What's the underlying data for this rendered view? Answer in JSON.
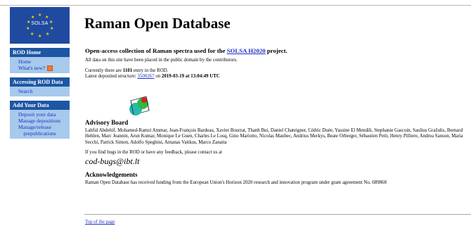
{
  "logo": {
    "text": "SOLSA"
  },
  "header": {
    "title": "Raman Open Database"
  },
  "sidebar": [
    {
      "heading": "ROD Home",
      "items": [
        {
          "label": "Home"
        },
        {
          "label": "What's new?"
        }
      ]
    },
    {
      "heading": "Accessing ROD Data",
      "items": [
        {
          "label": "Search"
        }
      ]
    },
    {
      "heading": "Add Your Data",
      "items": [
        {
          "label": "Deposit your data"
        },
        {
          "label": "Manage depositions"
        },
        {
          "label": "Manage/release"
        },
        {
          "label": "prepublications"
        }
      ]
    }
  ],
  "main": {
    "subtitle_pre": "Open-access collection of Raman spectra used for the ",
    "subtitle_link": "SOLSA H2020",
    "subtitle_post": " project.",
    "public_domain": "All data on this site have been placed in the public domain by the contributors.",
    "count_pre": "Currently there are ",
    "count": "1101",
    "count_post": " entry in the ROD.",
    "latest_pre": "Latest deposited structure: ",
    "latest_id": "3500267",
    "latest_on": " on ",
    "latest_date": "2019-03-19 at 13:04:49 UTC",
    "advisory_heading": "Advisory Board",
    "advisory_text": "Lahfid Abdeltif, Mohamed-Ramzi Ammar, Jean-François Bardeau, Xavier Bourrat, Thanh Bui, Daniel Chateigner, Cédric Duée, Yassine El Mendili, Stephanie Gascoin, Saulius Gražulis, Bernard Hehlen, Marc Jeannin, Arun Kumar, Monique Le Guen, Charles Le Losq, Gino Mariotto, Nicolas Maubec, Andrius Merkys, Beate Orberger, Sébastien Petit, Henry Pilliere, Andrea Sanson, Maria Secchi, Patrick Simon, Adolfo Speghini, Antanas Vaitkus, Marco Zanatta",
    "bugs_text": "If you find bugs in the ROD or have any feedback, please contact us at",
    "email": "cod-bugs@ibt.lt",
    "ack_heading": "Acknowledgements",
    "ack_text": "Raman Open Database has received funding from the European Union's Horizon 2020 research and innovation program under grant agreement No. 689868"
  },
  "footer": {
    "top_link": "Top of the page"
  },
  "colors": {
    "sidebar_header": "#1d56a3",
    "sidebar_body": "#a7c9ec",
    "link": "#1d2fbf",
    "logo_bg": "#1f4aa0",
    "logo_stars": "#ffd400"
  },
  "icons": {
    "new": "new-badge-icon",
    "structure": "crystal-structure-icon"
  }
}
